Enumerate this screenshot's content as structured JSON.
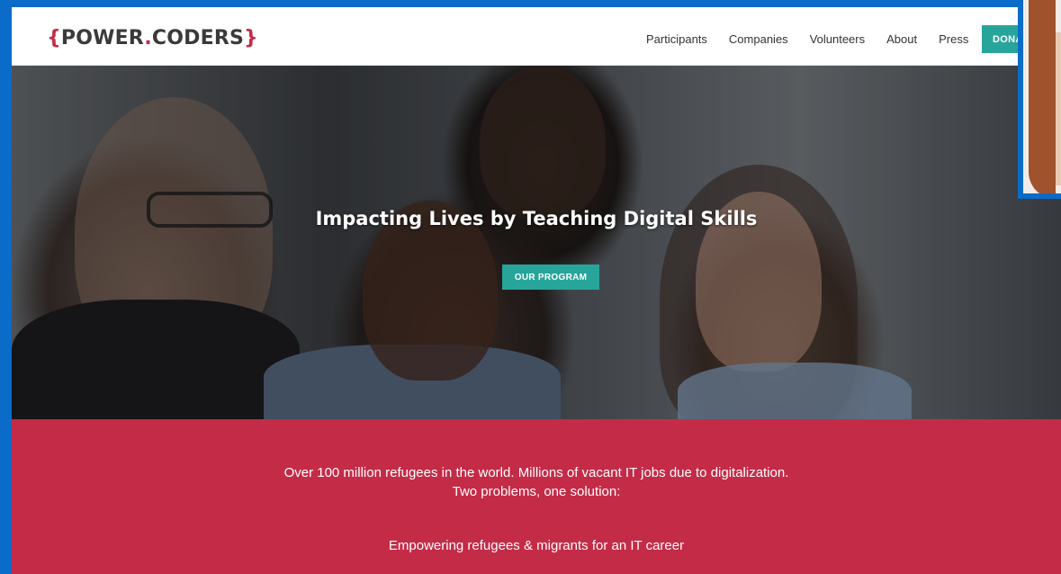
{
  "header": {
    "logo": {
      "open_brace": "{",
      "power": "POWER",
      "dot": ".",
      "coders": "CODERS",
      "close_brace": "}"
    },
    "nav": [
      "Participants",
      "Companies",
      "Volunteers",
      "About",
      "Press"
    ],
    "donate_label": "DONA"
  },
  "hero": {
    "title": "Impacting Lives by Teaching Digital Skills",
    "button_label": "OUR PROGRAM"
  },
  "banner": {
    "line1": "Over 100 million refugees in the world. Millions of vacant IT jobs due to digitalization.",
    "line2": "Two problems, one solution:",
    "line3": "Empowering refugees & migrants for an IT career"
  },
  "colors": {
    "brand_red": "#c42b47",
    "brand_teal": "#27a59a",
    "frame_blue": "#0a6bc9"
  }
}
